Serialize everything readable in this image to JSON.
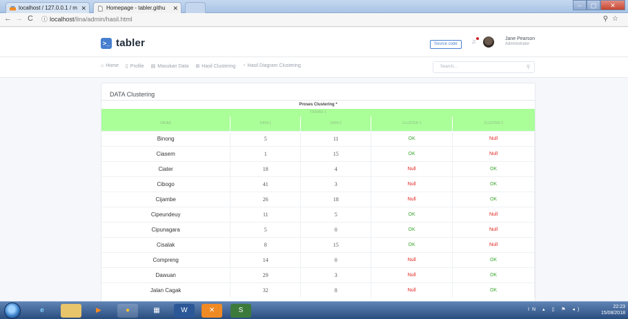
{
  "browser": {
    "tabs": [
      {
        "title": "localhost / 127.0.0.1 / m"
      },
      {
        "title": "Homepage - tabler.githu"
      }
    ],
    "url_host": "localhost",
    "url_path": "/lina/admin/hasil.html"
  },
  "header": {
    "brand": "tabler",
    "source_button": "Source code",
    "user_name": "Jane Pearson",
    "user_role": "Administrator"
  },
  "nav": {
    "items": [
      {
        "label": "Home",
        "icon": "home-icon"
      },
      {
        "label": "Profile",
        "icon": "file-icon"
      },
      {
        "label": "Masukan Data",
        "icon": "file-icon"
      },
      {
        "label": "Hasil Clustering",
        "icon": "grid-icon"
      },
      {
        "label": "Hasil Diagram Clustering",
        "icon": "chart-icon"
      }
    ],
    "search_placeholder": "Search..."
  },
  "card": {
    "title": "DATA Clustering",
    "process_label": "Proses Clustering *",
    "iteration_label": "ITERASI 1",
    "columns": [
      "OBJEK",
      "DATA 1",
      "DATA 2",
      "CLUSTER 1",
      "CLUSTER 2"
    ],
    "rows": [
      {
        "objek": "Binong",
        "data1": "5",
        "data2": "11",
        "c1": "OK",
        "c2": "Null"
      },
      {
        "objek": "Ciasem",
        "data1": "1",
        "data2": "15",
        "c1": "OK",
        "c2": "Null"
      },
      {
        "objek": "Ciater",
        "data1": "18",
        "data2": "4",
        "c1": "Null",
        "c2": "OK"
      },
      {
        "objek": "Cibogo",
        "data1": "41",
        "data2": "3",
        "c1": "Null",
        "c2": "OK"
      },
      {
        "objek": "Cijambe",
        "data1": "26",
        "data2": "18",
        "c1": "Null",
        "c2": "OK"
      },
      {
        "objek": "Cipeundeuy",
        "data1": "11",
        "data2": "5",
        "c1": "OK",
        "c2": "Null"
      },
      {
        "objek": "Cipunagara",
        "data1": "5",
        "data2": "0",
        "c1": "OK",
        "c2": "Null"
      },
      {
        "objek": "Cisalak",
        "data1": "8",
        "data2": "15",
        "c1": "OK",
        "c2": "Null"
      },
      {
        "objek": "Compreng",
        "data1": "14",
        "data2": "0",
        "c1": "Null",
        "c2": "OK"
      },
      {
        "objek": "Dawuan",
        "data1": "29",
        "data2": "3",
        "c1": "Null",
        "c2": "OK"
      },
      {
        "objek": "Jalan Cagak",
        "data1": "32",
        "data2": "8",
        "c1": "Null",
        "c2": "OK"
      }
    ]
  },
  "taskbar": {
    "lang": "IN",
    "time": "22:23",
    "date": "15/08/2018"
  }
}
